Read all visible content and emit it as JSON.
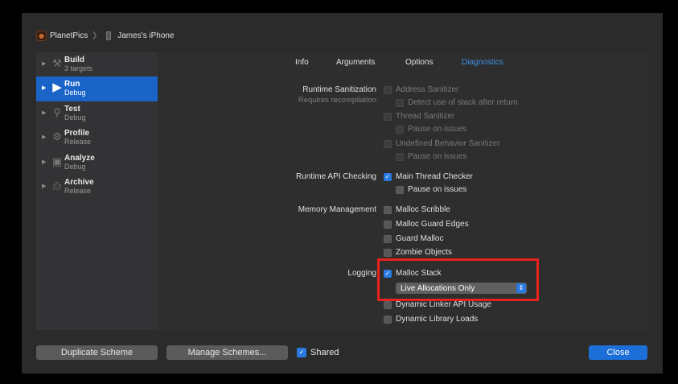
{
  "breadcrumb": {
    "app": "PlanetPics",
    "separator": "〉",
    "device": "James's iPhone"
  },
  "sidebar": {
    "items": [
      {
        "name": "Build",
        "sub": "3 targets",
        "icon": "hammer-icon"
      },
      {
        "name": "Run",
        "sub": "Debug",
        "icon": "play-icon"
      },
      {
        "name": "Test",
        "sub": "Debug",
        "icon": "wrench-icon"
      },
      {
        "name": "Profile",
        "sub": "Release",
        "icon": "instruments-icon"
      },
      {
        "name": "Analyze",
        "sub": "Debug",
        "icon": "analyze-icon"
      },
      {
        "name": "Archive",
        "sub": "Release",
        "icon": "archive-icon"
      }
    ],
    "selected": "Run"
  },
  "tabs": [
    "Info",
    "Arguments",
    "Options",
    "Diagnostics"
  ],
  "active_tab": "Diagnostics",
  "sections": {
    "runtime_sanitization": {
      "label": "Runtime Sanitization",
      "sublabel": "Requires recompilation",
      "options": {
        "address_sanitizer": "Address Sanitizer",
        "detect_stack": "Detect use of stack after return",
        "thread_sanitizer": "Thread Sanitizer",
        "pause_on_issues_1": "Pause on issues",
        "ub_sanitizer": "Undefined Behavior Sanitizer",
        "pause_on_issues_2": "Pause on issues"
      }
    },
    "runtime_api": {
      "label": "Runtime API Checking",
      "options": {
        "main_thread_checker": "Main Thread Checker",
        "pause_on_issues": "Pause on issues"
      }
    },
    "memory": {
      "label": "Memory Management",
      "options": {
        "malloc_scribble": "Malloc Scribble",
        "malloc_guard_edges": "Malloc Guard Edges",
        "guard_malloc": "Guard Malloc",
        "zombie_objects": "Zombie Objects"
      }
    },
    "logging": {
      "label": "Logging",
      "options": {
        "malloc_stack": "Malloc Stack",
        "malloc_stack_mode": "Live Allocations Only",
        "dynamic_linker": "Dynamic Linker API Usage",
        "dynamic_library": "Dynamic Library Loads"
      }
    }
  },
  "footer": {
    "duplicate": "Duplicate Scheme",
    "manage": "Manage Schemes...",
    "shared": "Shared",
    "close": "Close"
  },
  "colors": {
    "accent": "#2a7ae2",
    "selection": "#1a64c8",
    "highlight": "#e8231d"
  }
}
